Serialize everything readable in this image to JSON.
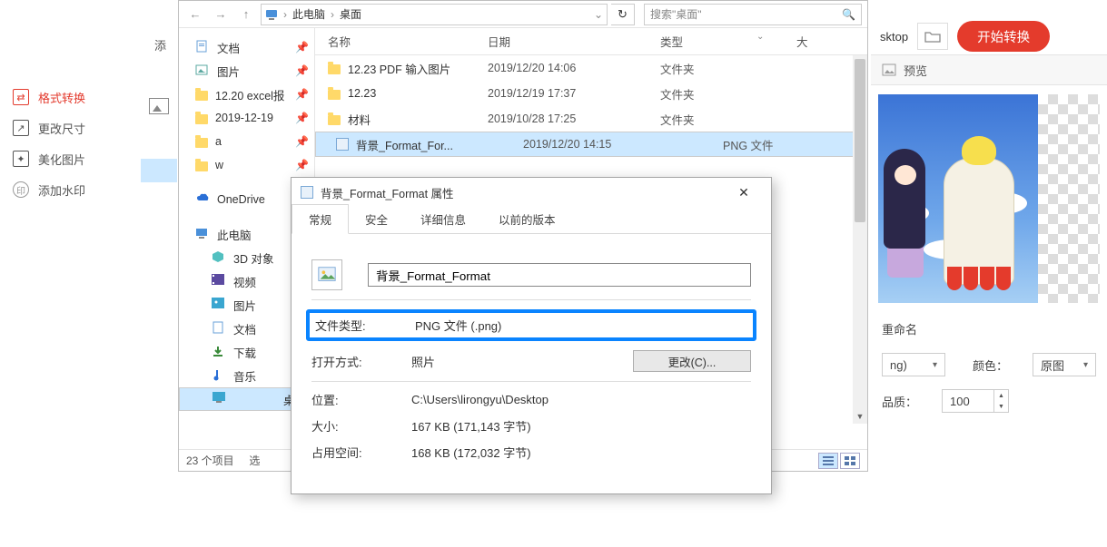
{
  "app_side": {
    "format": "格式转换",
    "resize": "更改尺寸",
    "beautify": "美化图片",
    "watermark": "添加水印",
    "watermark_glyph": "印"
  },
  "add_label": "添",
  "explorer": {
    "crumb1": "此电脑",
    "crumb2": "桌面",
    "search_placeholder": "搜索\"桌面\"",
    "cols": {
      "name": "名称",
      "date": "日期",
      "type": "类型",
      "size": "大"
    },
    "tree": [
      {
        "label": "文档",
        "icon": "doc",
        "pin": true
      },
      {
        "label": "图片",
        "icon": "pic",
        "pin": true
      },
      {
        "label": "12.20 excel报",
        "icon": "folder",
        "pin": true
      },
      {
        "label": "2019-12-19",
        "icon": "folder",
        "pin": true
      },
      {
        "label": "a",
        "icon": "folder",
        "pin": true
      },
      {
        "label": "w",
        "icon": "folder",
        "pin": true
      },
      {
        "label": "OneDrive",
        "icon": "cloud",
        "pin": false,
        "top": true
      },
      {
        "label": "此电脑",
        "icon": "pc",
        "pin": false,
        "top": true
      },
      {
        "label": "3D 对象",
        "icon": "3d",
        "lvl": 2
      },
      {
        "label": "视频",
        "icon": "vid",
        "lvl": 2
      },
      {
        "label": "图片",
        "icon": "pic2",
        "lvl": 2
      },
      {
        "label": "文档",
        "icon": "doc2",
        "lvl": 2
      },
      {
        "label": "下载",
        "icon": "dl",
        "lvl": 2
      },
      {
        "label": "音乐",
        "icon": "mus",
        "lvl": 2
      },
      {
        "label": "桌面",
        "icon": "desk",
        "lvl": 2,
        "sel": true
      }
    ],
    "rows": [
      {
        "name": "12.23 PDF 输入图片",
        "date": "2019/12/20 14:06",
        "type": "文件夹",
        "icon": "folder"
      },
      {
        "name": "12.23",
        "date": "2019/12/19 17:37",
        "type": "文件夹",
        "icon": "folder"
      },
      {
        "name": "材料",
        "date": "2019/10/28 17:25",
        "type": "文件夹",
        "icon": "folder"
      },
      {
        "name": "背景_Format_For...",
        "date": "2019/12/20 14:15",
        "type": "PNG 文件",
        "icon": "png",
        "sel": true
      }
    ],
    "status_count": "23 个项目",
    "status_sel": "选"
  },
  "props": {
    "title": "背景_Format_Format 属性",
    "tabs": [
      "常规",
      "安全",
      "详细信息",
      "以前的版本"
    ],
    "filename": "背景_Format_Format",
    "filetype_label": "文件类型:",
    "filetype_value": "PNG 文件 (.png)",
    "openwith_label": "打开方式:",
    "openwith_value": "照片",
    "change_btn": "更改(C)...",
    "location_label": "位置:",
    "location_value": "C:\\Users\\lirongyu\\Desktop",
    "size_label": "大小:",
    "size_value": "167 KB (171,143 字节)",
    "disk_label": "占用空间:",
    "disk_value": "168 KB (172,032 字节)"
  },
  "right": {
    "desktop_label": "sktop",
    "start_btn": "开始转换",
    "preview": "预览",
    "rename": "重命名",
    "ext": "ng)",
    "color_label": "颜色：",
    "color_value": "原图",
    "quality_label": "品质：",
    "quality_value": "100"
  }
}
